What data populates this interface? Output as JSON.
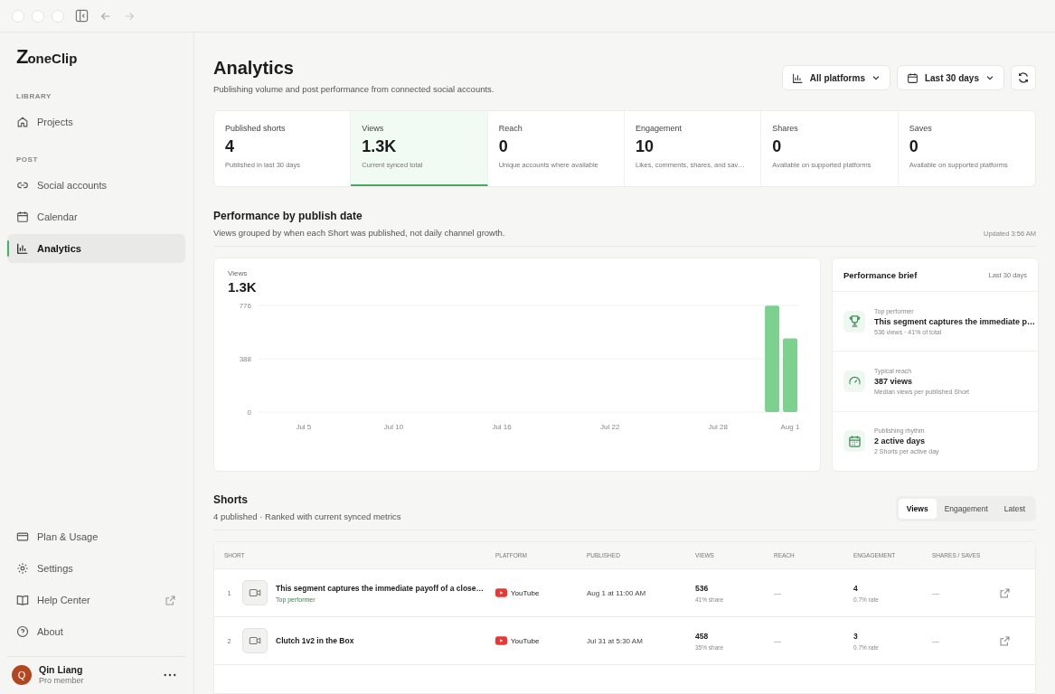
{
  "sidebar": {
    "brand": {
      "mark": "Z",
      "name": "oneClip"
    },
    "sections": [
      {
        "heading": "LIBRARY",
        "items": [
          {
            "label": "Projects",
            "selected": false
          }
        ]
      },
      {
        "heading": "POST",
        "items": [
          {
            "label": "Social accounts",
            "selected": false
          },
          {
            "label": "Calendar",
            "selected": false
          },
          {
            "label": "Analytics",
            "selected": true
          }
        ]
      }
    ],
    "bottom_items": [
      {
        "label": "Plan & Usage",
        "external": false
      },
      {
        "label": "Settings",
        "external": false
      },
      {
        "label": "Help Center",
        "external": true
      },
      {
        "label": "About",
        "external": false
      }
    ],
    "user": {
      "initial": "Q",
      "name": "Qin Liang",
      "role": "Pro member"
    }
  },
  "header": {
    "title": "Analytics",
    "subtitle": "Publishing volume and post performance from connected social accounts.",
    "platform_filter": "All platforms",
    "date_filter": "Last 30 days"
  },
  "stats": [
    {
      "label": "Published shorts",
      "value": "4",
      "note": "Published in last 30 days",
      "selected": false
    },
    {
      "label": "Views",
      "value": "1.3K",
      "note": "Current synced total",
      "selected": true
    },
    {
      "label": "Reach",
      "value": "0",
      "note": "Unique accounts where available",
      "selected": false
    },
    {
      "label": "Engagement",
      "value": "10",
      "note": "Likes, comments, shares, and sav…",
      "selected": false
    },
    {
      "label": "Shares",
      "value": "0",
      "note": "Available on supported platforms",
      "selected": false
    },
    {
      "label": "Saves",
      "value": "0",
      "note": "Available on supported platforms",
      "selected": false
    }
  ],
  "performance": {
    "title": "Performance by publish date",
    "subtitle": "Views grouped by when each Short was published, not daily channel growth.",
    "updated": "Updated 3:56 AM",
    "chart": {
      "label": "Views",
      "total": "1.3K",
      "chart_data": {
        "type": "bar",
        "categories": [
          null,
          null,
          "Jul 5",
          null,
          null,
          null,
          null,
          "Jul 10",
          null,
          null,
          null,
          null,
          null,
          "Jul 16",
          null,
          null,
          null,
          null,
          null,
          "Jul 22",
          null,
          null,
          null,
          null,
          null,
          "Jul 28",
          null,
          null,
          null,
          "Aug 1"
        ],
        "series": [
          {
            "color": "#7dd18f",
            "values": [
              null,
              null,
              null,
              null,
              null,
              null,
              null,
              null,
              null,
              null,
              null,
              null,
              null,
              null,
              null,
              null,
              null,
              null,
              null,
              null,
              null,
              null,
              null,
              null,
              null,
              null,
              null,
              null,
              774,
              536
            ]
          }
        ],
        "ylim": [
          0,
          776
        ],
        "yticks": [
          0,
          388,
          776
        ]
      }
    },
    "brief": {
      "title": "Performance brief",
      "period": "Last 30 days",
      "items": [
        {
          "kind": "trophy",
          "label": "Top performer",
          "value": "This segment captures the immediate p…",
          "note": "536 views · 41% of total"
        },
        {
          "kind": "gauge",
          "label": "Typical reach",
          "value": "387 views",
          "note": "Median views per published Short"
        },
        {
          "kind": "calendar",
          "label": "Publishing rhythm",
          "value": "2 active days",
          "note": "2 Shorts per active day"
        }
      ]
    }
  },
  "shorts": {
    "title": "Shorts",
    "subtitle": "4 published · Ranked with current synced metrics",
    "sort_tabs": [
      {
        "label": "Views",
        "selected": true
      },
      {
        "label": "Engagement",
        "selected": false
      },
      {
        "label": "Latest",
        "selected": false
      }
    ],
    "columns": [
      "SHORT",
      "PLATFORM",
      "PUBLISHED",
      "VIEWS",
      "REACH",
      "ENGAGEMENT",
      "SHARES / SAVES"
    ],
    "rows": [
      {
        "rank": "1",
        "title": "This segment captures the immediate payoff of a close…",
        "badge": "Top performer",
        "platform": "YouTube",
        "published": "Aug 1 at 11:00 AM",
        "views": "536",
        "views_note": "41% share",
        "reach": "—",
        "engagement": "4",
        "engagement_note": "0.7% rate",
        "shares_saves": "—"
      },
      {
        "rank": "2",
        "title": "Clutch 1v2 in the Box",
        "platform": "YouTube",
        "published": "Jul 31 at 5:30 AM",
        "views": "458",
        "views_note": "35% share",
        "reach": "—",
        "engagement": "3",
        "engagement_note": "0.7% rate",
        "shares_saves": "—"
      }
    ]
  }
}
